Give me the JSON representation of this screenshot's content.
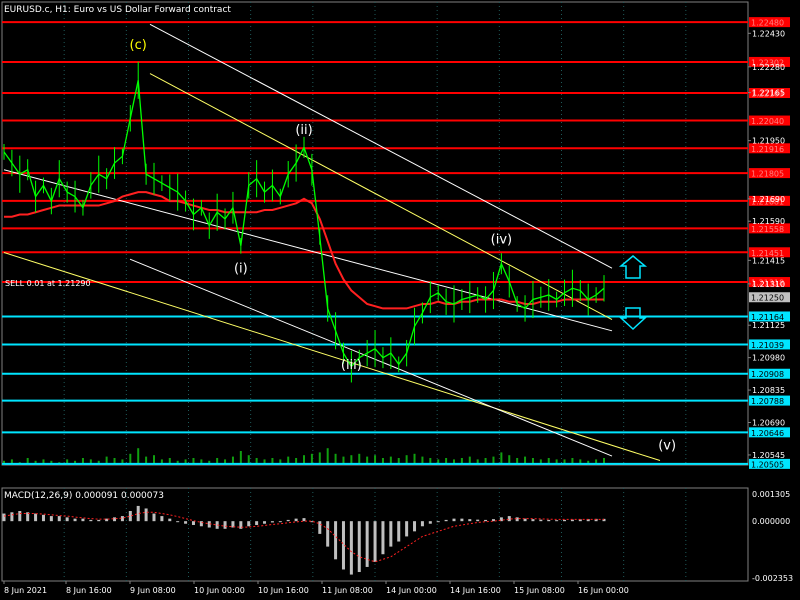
{
  "chart_data": {
    "type": "line",
    "title": "EURUSD.c, H1:  Euro vs US Dollar Forward contract",
    "trade_label": "SELL 0.01 at 1.21290",
    "indicator_label": "MACD(12,26,9) 0.000091 0.000073",
    "current_price": "1.21250",
    "ylim": [
      1.205,
      1.2257
    ],
    "price_ticks": [
      "1.22575",
      "1.22430",
      "1.22280",
      "1.22165",
      "1.22040",
      "1.21950",
      "1.21805",
      "1.21690",
      "1.21590",
      "1.21415",
      "1.21310",
      "1.21250",
      "1.21164",
      "1.21125",
      "1.21039",
      "1.20980",
      "1.20908",
      "1.20835",
      "1.20788",
      "1.20690",
      "1.20646",
      "1.20545",
      "1.20505"
    ],
    "resistance_levels": [
      {
        "value": 1.2248,
        "label": "1.22480"
      },
      {
        "value": 1.22302,
        "label": "1.22302"
      },
      {
        "value": 1.22163,
        "label": "1.22163"
      },
      {
        "value": 1.2204,
        "label": "1.22040"
      },
      {
        "value": 1.21916,
        "label": "1.21916"
      },
      {
        "value": 1.21805,
        "label": "1.21805"
      },
      {
        "value": 1.21681,
        "label": "1.21681"
      },
      {
        "value": 1.21558,
        "label": "1.21558"
      },
      {
        "value": 1.21451,
        "label": "1.21451"
      },
      {
        "value": 1.21318,
        "label": "1.21318"
      }
    ],
    "support_levels": [
      {
        "value": 1.21164,
        "label": "1.21164"
      },
      {
        "value": 1.21039,
        "label": "1.21039"
      },
      {
        "value": 1.20908,
        "label": "1.20908"
      },
      {
        "value": 1.20788,
        "label": "1.20788"
      },
      {
        "value": 1.20646,
        "label": "1.20646"
      },
      {
        "value": 1.20505,
        "label": "1.20505"
      }
    ],
    "x_ticks": [
      "8 Jun 2021",
      "8 Jun 16:00",
      "9 Jun 08:00",
      "10 Jun 00:00",
      "10 Jun 16:00",
      "11 Jun 08:00",
      "14 Jun 00:00",
      "14 Jun 16:00",
      "15 Jun 08:00",
      "16 Jun 00:00"
    ],
    "wave_labels": [
      {
        "text": "(c)",
        "bar": 17,
        "value": 1.2236
      },
      {
        "text": "(ii)",
        "bar": 38,
        "value": 1.2198
      },
      {
        "text": "(i)",
        "bar": 30,
        "value": 1.2136
      },
      {
        "text": "(iii)",
        "bar": 44,
        "value": 1.2093
      },
      {
        "text": "(iv)",
        "bar": 63,
        "value": 1.2149
      },
      {
        "text": "(v)",
        "bar": 84,
        "value": 1.2057
      }
    ],
    "price_series": [
      1.219,
      1.2185,
      1.218,
      1.2182,
      1.217,
      1.2175,
      1.2168,
      1.2178,
      1.2172,
      1.217,
      1.2165,
      1.2175,
      1.218,
      1.2178,
      1.2185,
      1.2188,
      1.2205,
      1.2222,
      1.218,
      1.2178,
      1.2176,
      1.2174,
      1.2172,
      1.2168,
      1.2162,
      1.2165,
      1.2157,
      1.2163,
      1.216,
      1.2165,
      1.2148,
      1.2175,
      1.2178,
      1.2172,
      1.2175,
      1.217,
      1.218,
      1.2185,
      1.2192,
      1.2182,
      1.2152,
      1.212,
      1.211,
      1.21,
      1.2094,
      1.2098,
      1.21,
      1.2102,
      1.2098,
      1.21,
      1.2095,
      1.21,
      1.2112,
      1.2118,
      1.2125,
      1.2127,
      1.2123,
      1.2122,
      1.2124,
      1.2125,
      1.2126,
      1.2124,
      1.2128,
      1.214,
      1.2132,
      1.2122,
      1.212,
      1.2124,
      1.2125,
      1.2126,
      1.2124,
      1.2127,
      1.2129,
      1.2128,
      1.2124,
      1.2126,
      1.2129
    ],
    "ma_series": [
      1.2161,
      1.2161,
      1.2162,
      1.2162,
      1.2163,
      1.2164,
      1.2165,
      1.2166,
      1.2166,
      1.2166,
      1.2166,
      1.2166,
      1.2166,
      1.2167,
      1.2168,
      1.217,
      1.2171,
      1.2172,
      1.2172,
      1.2171,
      1.217,
      1.2168,
      1.2168,
      1.2167,
      1.2166,
      1.2165,
      1.2164,
      1.2164,
      1.2163,
      1.2163,
      1.2163,
      1.2163,
      1.2163,
      1.2164,
      1.2164,
      1.2165,
      1.2166,
      1.2167,
      1.2169,
      1.2167,
      1.216,
      1.215,
      1.214,
      1.2133,
      1.2128,
      1.2125,
      1.2122,
      1.2121,
      1.212,
      1.212,
      1.212,
      1.212,
      1.2121,
      1.2122,
      1.2122,
      1.2123,
      1.2122,
      1.2122,
      1.2123,
      1.2123,
      1.2124,
      1.2124,
      1.2124,
      1.2124,
      1.2123,
      1.2123,
      1.2122,
      1.2122,
      1.2123,
      1.2123,
      1.2123,
      1.2124,
      1.2124,
      1.2124,
      1.2124,
      1.2124,
      1.2124
    ],
    "volume_series": [
      3,
      4,
      2,
      5,
      3,
      4,
      3,
      2,
      4,
      3,
      5,
      4,
      3,
      6,
      5,
      4,
      8,
      12,
      6,
      7,
      4,
      5,
      3,
      4,
      5,
      4,
      3,
      5,
      4,
      6,
      10,
      7,
      5,
      4,
      5,
      4,
      6,
      5,
      7,
      8,
      9,
      12,
      8,
      6,
      7,
      8,
      6,
      7,
      5,
      6,
      5,
      7,
      8,
      6,
      5,
      4,
      5,
      4,
      5,
      6,
      4,
      5,
      6,
      9,
      7,
      5,
      6,
      5,
      4,
      5,
      4,
      4,
      5,
      4,
      3,
      4,
      5
    ],
    "macd_ylim": [
      -0.002353,
      0.001305
    ],
    "macd_ticks": [
      "0.001305",
      "0.000000",
      "-0.002353"
    ],
    "macd_hist": [
      0.0003,
      0.00035,
      0.0004,
      0.00035,
      0.0003,
      0.00025,
      0.0002,
      0.0002,
      0.00015,
      0.0001,
      0.0001,
      5e-05,
      5e-05,
      0.0001,
      0.00015,
      0.0002,
      0.0004,
      0.0006,
      0.0005,
      0.0003,
      0.0002,
      0.0001,
      0.0,
      -0.0001,
      -0.00015,
      -0.0002,
      -0.00025,
      -0.0003,
      -0.0003,
      -0.00025,
      -0.0003,
      -0.0002,
      -0.00015,
      -0.0001,
      -5e-05,
      0.0,
      5e-05,
      0.0001,
      0.00012,
      0.0,
      -0.0005,
      -0.001,
      -0.0015,
      -0.0019,
      -0.0021,
      -0.002,
      -0.0018,
      -0.0016,
      -0.0013,
      -0.001,
      -0.0008,
      -0.0006,
      -0.0004,
      -0.0002,
      -0.0001,
      0.0,
      5e-05,
      0.0001,
      0.0001,
      8e-05,
      6e-05,
      5e-05,
      8e-05,
      0.00015,
      0.0002,
      0.00015,
      0.0001,
      8e-05,
      6e-05,
      5e-05,
      4e-05,
      5e-05,
      6e-05,
      7e-05,
      8e-05,
      9e-05,
      9.1e-05
    ],
    "macd_signal": [
      0.0002,
      0.00025,
      0.0003,
      0.0003,
      0.0003,
      0.00028,
      0.00025,
      0.00022,
      0.0002,
      0.00016,
      0.00013,
      0.0001,
      8e-05,
      8e-05,
      0.0001,
      0.00012,
      0.0002,
      0.0003,
      0.00035,
      0.00035,
      0.0003,
      0.00025,
      0.00018,
      0.0001,
      2e-05,
      -5e-05,
      -0.0001,
      -0.00015,
      -0.0002,
      -0.00022,
      -0.00024,
      -0.00023,
      -0.0002,
      -0.00017,
      -0.00013,
      -0.0001,
      -6e-05,
      -3e-05,
      0.0,
      0.0,
      -0.0001,
      -0.0003,
      -0.0006,
      -0.0009,
      -0.0012,
      -0.0014,
      -0.0015,
      -0.0016,
      -0.0015,
      -0.0014,
      -0.0012,
      -0.001,
      -0.0008,
      -0.0006,
      -0.0005,
      -0.0004,
      -0.0003,
      -0.0002,
      -0.00015,
      -0.0001,
      -5e-05,
      -2e-05,
      0.0,
      4e-05,
      8e-05,
      0.0001,
      0.0001,
      0.0001,
      9e-05,
      8e-05,
      7e-05,
      7e-05,
      7e-05,
      7e-05,
      7e-05,
      7e-05,
      7.3e-05
    ],
    "colors": {
      "background": "#000000",
      "grid": "#1e5a5a",
      "price": "#00ff00",
      "ma": "#ff2020",
      "resistance": "#ff0000",
      "support": "#00e5ff",
      "channel_white": "#ffffff",
      "channel_yellow": "#ffff66",
      "macd_hist": "#c0c0c0",
      "macd_signal": "#ff2020",
      "wave_c": "#ffff00",
      "wave_other": "#ffffff",
      "arrow": "#00e5ff",
      "current_price_box": "#c0c0c0"
    }
  }
}
